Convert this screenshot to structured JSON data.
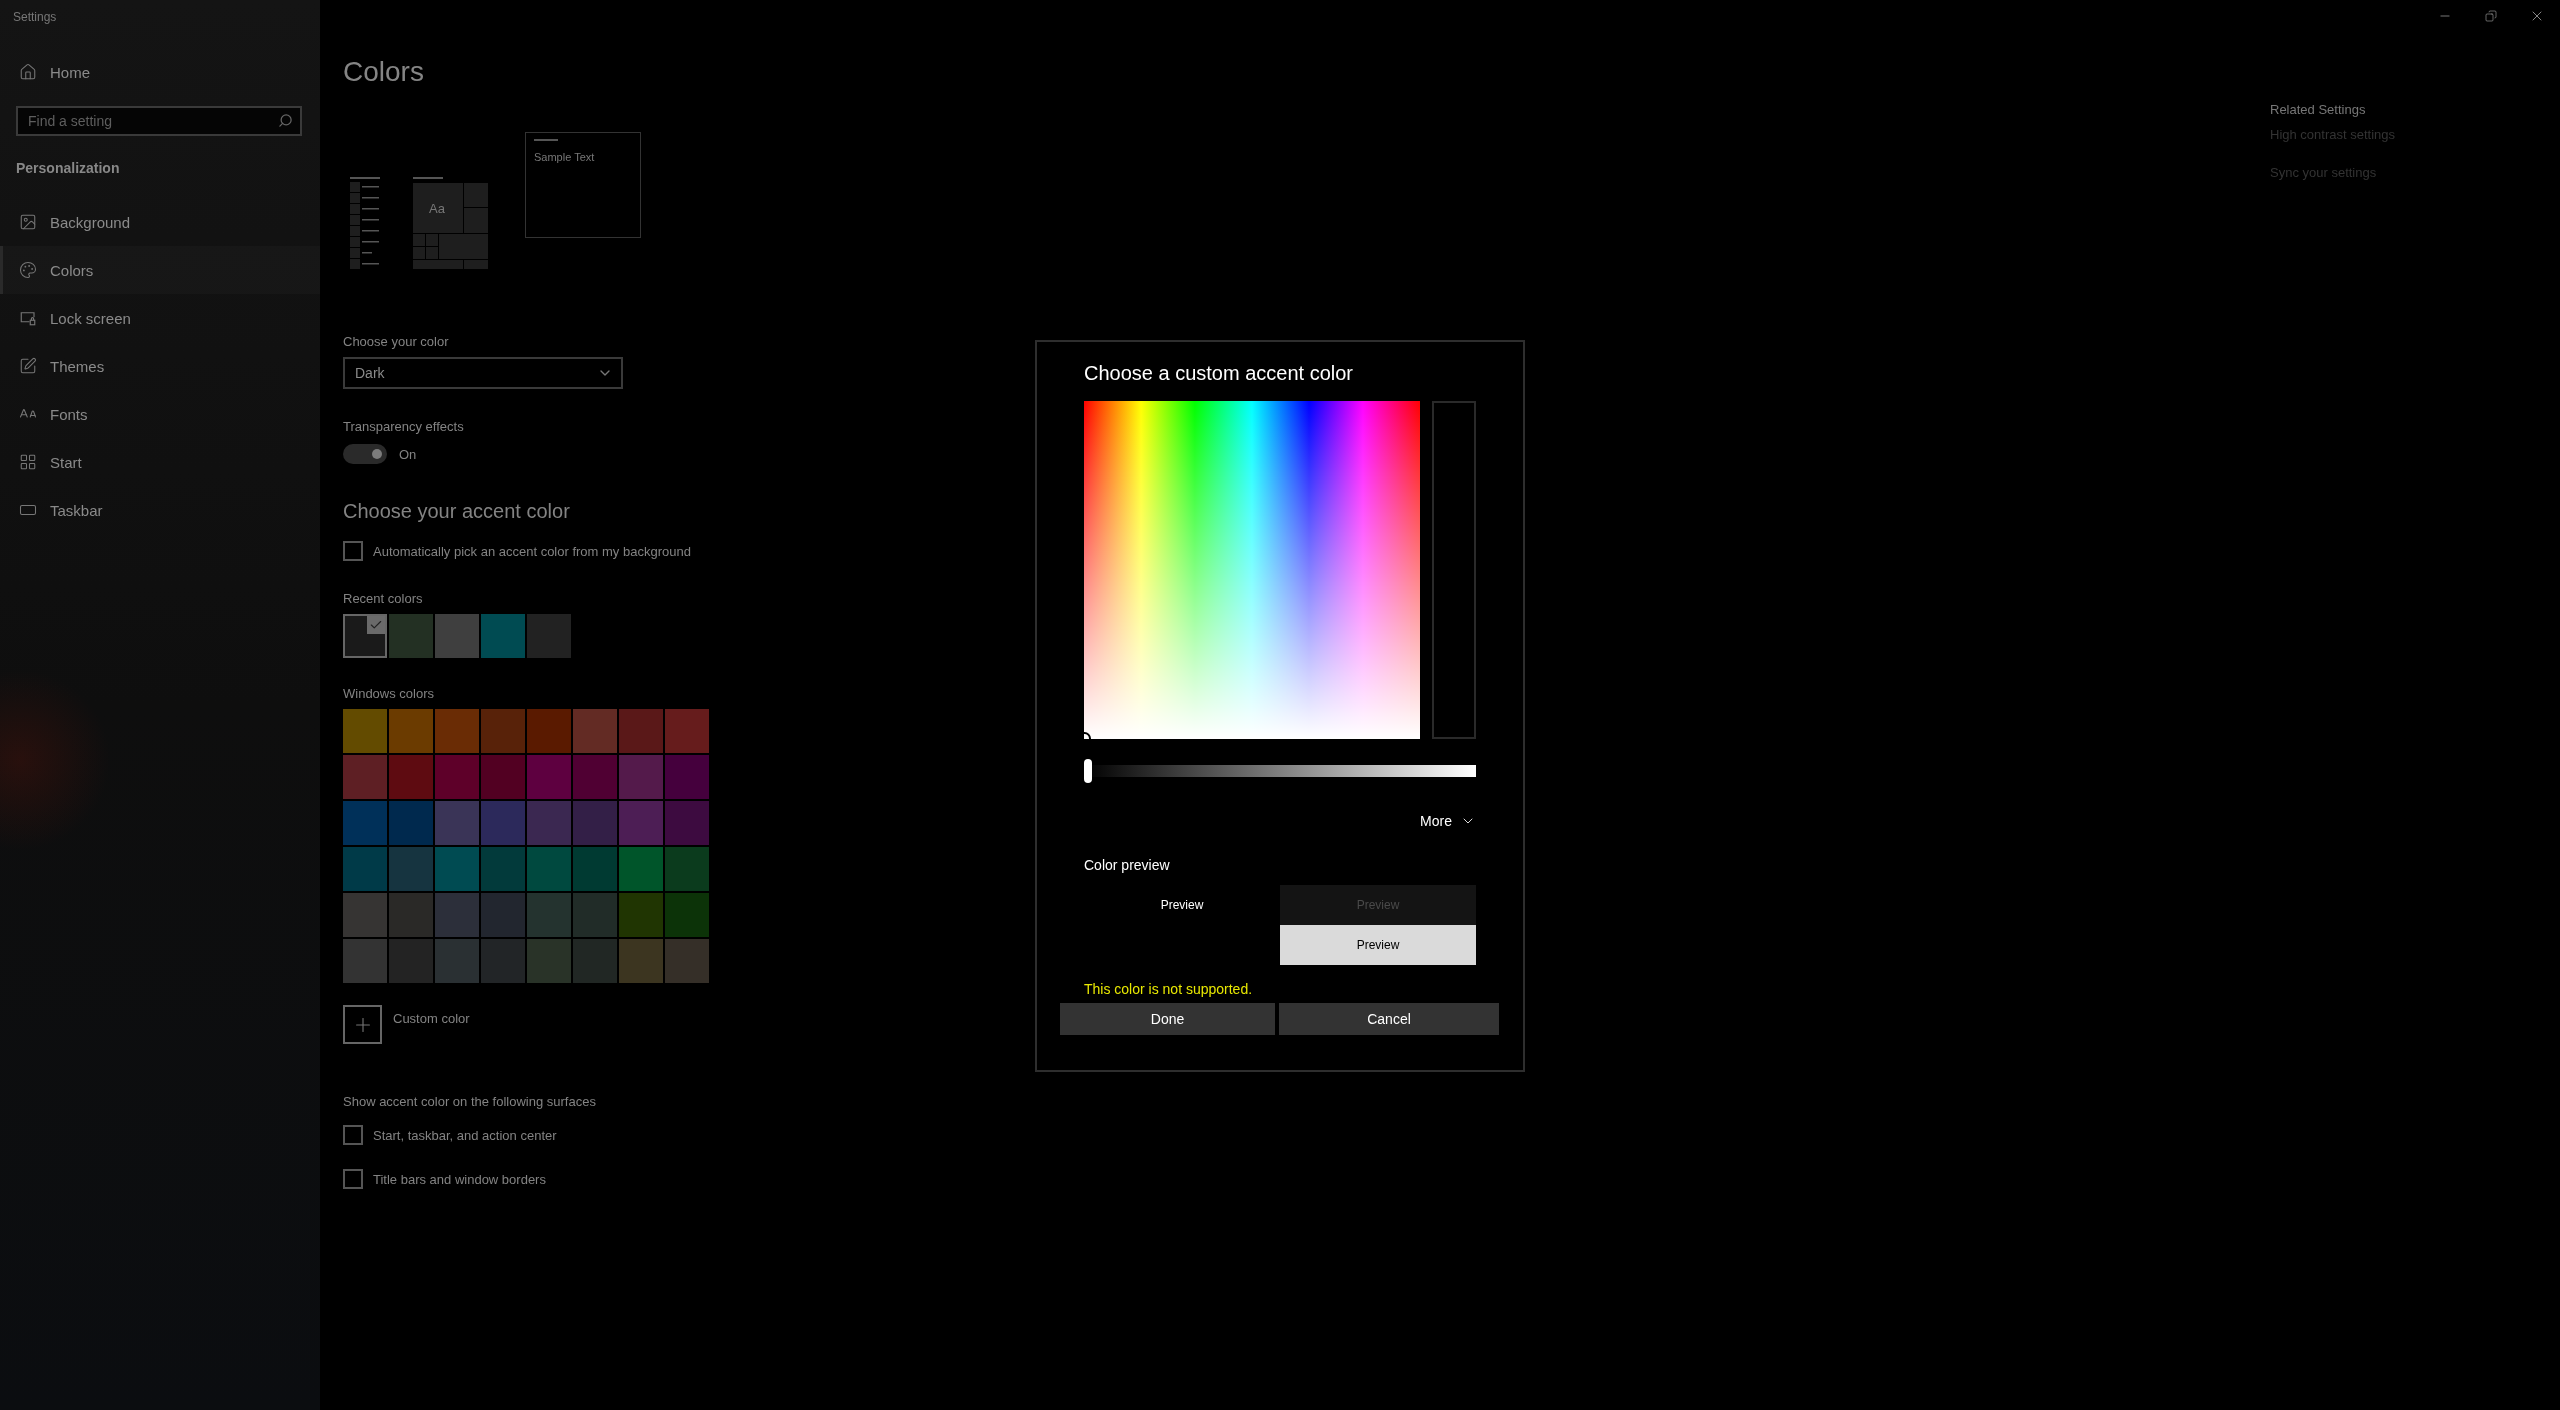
{
  "window": {
    "title": "Settings"
  },
  "sidebar": {
    "home": "Home",
    "search": {
      "placeholder": "Find a setting"
    },
    "section": "Personalization",
    "items": [
      {
        "label": "Background",
        "selected": false
      },
      {
        "label": "Colors",
        "selected": true
      },
      {
        "label": "Lock screen",
        "selected": false
      },
      {
        "label": "Themes",
        "selected": false
      },
      {
        "label": "Fonts",
        "selected": false
      },
      {
        "label": "Start",
        "selected": false
      },
      {
        "label": "Taskbar",
        "selected": false
      }
    ]
  },
  "main": {
    "title": "Colors",
    "preview": {
      "tile_text": "Aa",
      "sample_text": "Sample Text"
    },
    "choose_color": {
      "label": "Choose your color",
      "value": "Dark"
    },
    "transparency": {
      "label": "Transparency effects",
      "on": true,
      "state_text": "On"
    },
    "accent_heading": "Choose your accent color",
    "auto_pick": {
      "label": "Automatically pick an accent color from my background",
      "checked": false
    },
    "recent_colors": {
      "label": "Recent colors",
      "swatches": [
        {
          "color": "#1a1a1a",
          "selected": true
        },
        {
          "color": "#233023",
          "selected": false
        },
        {
          "color": "#3f3f3f",
          "selected": false
        },
        {
          "color": "#004b52",
          "selected": false
        },
        {
          "color": "#222222",
          "selected": false
        }
      ]
    },
    "windows_colors": {
      "label": "Windows colors",
      "rows": [
        [
          {
            "color": "#634b00",
            "selected": false
          },
          {
            "color": "#6b3b00",
            "selected": false
          },
          {
            "color": "#6a2c05",
            "selected": false
          },
          {
            "color": "#582209",
            "selected": false
          },
          {
            "color": "#5a1a00",
            "selected": false
          },
          {
            "color": "#632b24",
            "selected": false
          },
          {
            "color": "#5a1818",
            "selected": false
          },
          {
            "color": "#661c1c",
            "selected": false
          }
        ],
        [
          {
            "color": "#5e1f24",
            "selected": false
          },
          {
            "color": "#5e0b11",
            "selected": false
          },
          {
            "color": "#5e0029",
            "selected": false
          },
          {
            "color": "#520022",
            "selected": false
          },
          {
            "color": "#5e0040",
            "selected": false
          },
          {
            "color": "#500033",
            "selected": false
          },
          {
            "color": "#541a4b",
            "selected": false
          },
          {
            "color": "#45003d",
            "selected": false
          }
        ],
        [
          {
            "color": "#003059",
            "selected": false
          },
          {
            "color": "#00294e",
            "selected": false
          },
          {
            "color": "#3a3457",
            "selected": false
          },
          {
            "color": "#2c295b",
            "selected": false
          },
          {
            "color": "#3b2851",
            "selected": false
          },
          {
            "color": "#331f47",
            "selected": false
          },
          {
            "color": "#4d1e55",
            "selected": false
          },
          {
            "color": "#3d0b40",
            "selected": false
          }
        ],
        [
          {
            "color": "#003a48",
            "selected": false
          },
          {
            "color": "#163440",
            "selected": false
          },
          {
            "color": "#004b52",
            "selected": false
          },
          {
            "color": "#023a3b",
            "selected": false
          },
          {
            "color": "#00493f",
            "selected": false
          },
          {
            "color": "#003a32",
            "selected": false
          },
          {
            "color": "#00552a",
            "selected": false
          },
          {
            "color": "#0b3b1d",
            "selected": false
          }
        ],
        [
          {
            "color": "#363433",
            "selected": false
          },
          {
            "color": "#2a2927",
            "selected": false
          },
          {
            "color": "#2c2f3a",
            "selected": false
          },
          {
            "color": "#22262f",
            "selected": false
          },
          {
            "color": "#24332f",
            "selected": false
          },
          {
            "color": "#212c28",
            "selected": false
          },
          {
            "color": "#203502",
            "selected": false
          },
          {
            "color": "#0c3308",
            "selected": false
          }
        ],
        [
          {
            "color": "#333333",
            "selected": false
          },
          {
            "color": "#232323",
            "selected": false
          },
          {
            "color": "#2a3033",
            "selected": false
          },
          {
            "color": "#222527",
            "selected": false
          },
          {
            "color": "#293328",
            "selected": false
          },
          {
            "color": "#212724",
            "selected": false
          },
          {
            "color": "#3c3520",
            "selected": false
          },
          {
            "color": "#352f28",
            "selected": false
          }
        ]
      ]
    },
    "custom_color": "Custom color",
    "surfaces": {
      "label": "Show accent color on the following surfaces",
      "options": [
        {
          "label": "Start, taskbar, and action center",
          "checked": false
        },
        {
          "label": "Title bars and window borders",
          "checked": false
        }
      ]
    }
  },
  "related": {
    "heading": "Related Settings",
    "links": [
      "High contrast settings",
      "Sync your settings"
    ]
  },
  "dialog": {
    "title": "Choose a custom accent color",
    "value_slider": {
      "level": 0
    },
    "more": "More",
    "preview_label": "Color preview",
    "previews": [
      "Preview",
      "Preview",
      "Preview"
    ],
    "error": "This color is not supported.",
    "buttons": [
      "Done",
      "Cancel"
    ]
  }
}
